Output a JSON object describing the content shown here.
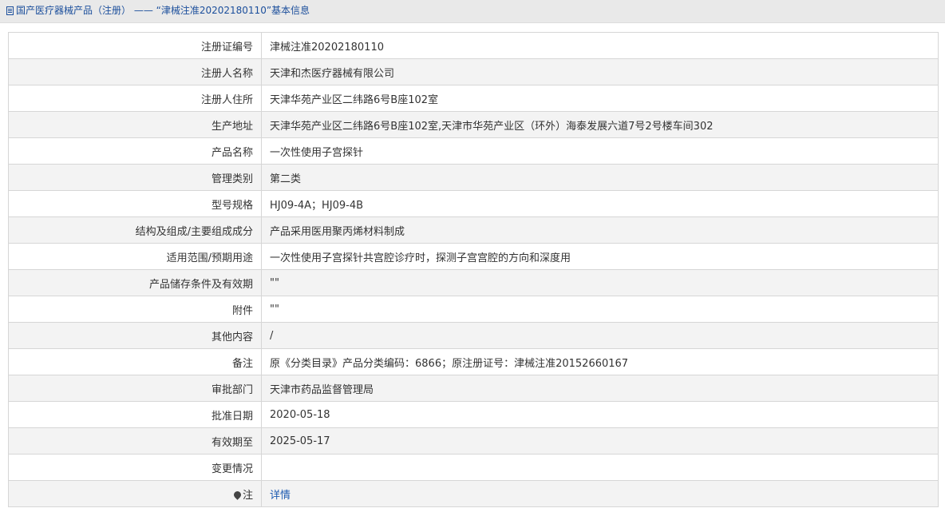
{
  "breadcrumb": {
    "icon": "document-icon",
    "text": "国产医疗器械产品（注册） —— “津械注准20202180110”基本信息"
  },
  "rows": [
    {
      "label": "注册证编号",
      "value": "津械注准20202180110"
    },
    {
      "label": "注册人名称",
      "value": "天津和杰医疗器械有限公司"
    },
    {
      "label": "注册人住所",
      "value": "天津华苑产业区二纬路6号B座102室"
    },
    {
      "label": "生产地址",
      "value": "天津华苑产业区二纬路6号B座102室,天津市华苑产业区（环外）海泰发展六道7号2号楼车间302"
    },
    {
      "label": "产品名称",
      "value": "一次性使用子宫探针"
    },
    {
      "label": "管理类别",
      "value": "第二类"
    },
    {
      "label": "型号规格",
      "value": "HJ09-4A；HJ09-4B"
    },
    {
      "label": "结构及组成/主要组成成分",
      "value": "产品采用医用聚丙烯材料制成"
    },
    {
      "label": "适用范围/预期用途",
      "value": "一次性使用子宫探针共宫腔诊疗时，探测子宫宫腔的方向和深度用"
    },
    {
      "label": "产品储存条件及有效期",
      "value": "\"\""
    },
    {
      "label": "附件",
      "value": "\"\""
    },
    {
      "label": "其他内容",
      "value": "/"
    },
    {
      "label": "备注",
      "value": "原《分类目录》产品分类编码：6866；原注册证号：津械注准20152660167"
    },
    {
      "label": "审批部门",
      "value": "天津市药品监督管理局"
    },
    {
      "label": "批准日期",
      "value": "2020-05-18"
    },
    {
      "label": "有效期至",
      "value": "2025-05-17"
    },
    {
      "label": "变更情况",
      "value": ""
    }
  ],
  "note_row": {
    "icon": "pin-icon",
    "label": "注",
    "link_text": "详情"
  },
  "colors": {
    "link": "#1c5ab0",
    "breadcrumb": "#1c4f9c",
    "row_alt": "#f3f3f3",
    "border": "#d6d6d6"
  }
}
